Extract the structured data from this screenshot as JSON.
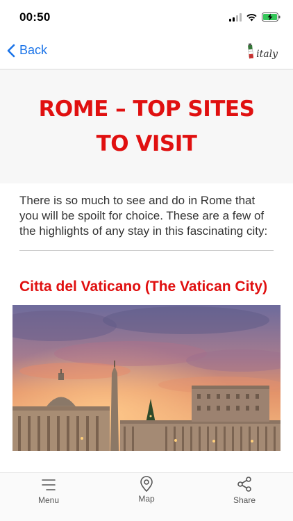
{
  "status": {
    "time": "00:50"
  },
  "nav": {
    "back_label": "Back",
    "logo_text": "italy"
  },
  "article": {
    "title_line1": "ROME – TOP SITES",
    "title_line2": "TO VISIT",
    "intro": "There is so much to see and do in Rome that you will be spoilt for choice. These are a few of the highlights of any stay in this fascinating city:",
    "section_heading": "Citta del Vaticano (The Vatican City)"
  },
  "tabs": [
    {
      "label": "Menu",
      "icon": "menu-icon"
    },
    {
      "label": "Map",
      "icon": "map-pin-icon"
    },
    {
      "label": "Share",
      "icon": "share-icon"
    }
  ],
  "colors": {
    "accent_red": "#e01010",
    "link_blue": "#1a73e8",
    "battery_green": "#34c759"
  }
}
